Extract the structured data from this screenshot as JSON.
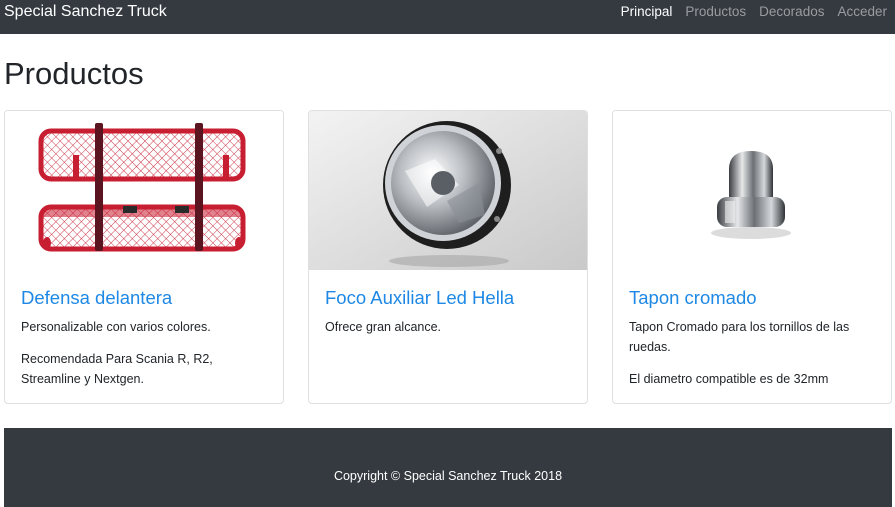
{
  "navbar": {
    "brand": "Special Sanchez Truck",
    "links": [
      {
        "label": "Principal",
        "active": true
      },
      {
        "label": "Productos",
        "active": false
      },
      {
        "label": "Decorados",
        "active": false
      },
      {
        "label": "Acceder",
        "active": false
      }
    ]
  },
  "page": {
    "title": "Productos"
  },
  "products": [
    {
      "title": "Defensa delantera",
      "image_icon": "red-grille-guard-image",
      "texts": [
        "Personalizable con varios colores.",
        "Recomendada Para Scania R, R2, Streamline y Nextgen."
      ]
    },
    {
      "title": "Foco Auxiliar Led Hella",
      "image_icon": "round-led-spotlight-image",
      "texts": [
        "Ofrece gran alcance."
      ]
    },
    {
      "title": "Tapon cromado",
      "image_icon": "chrome-nut-cap-image",
      "texts": [
        "Tapon Cromado para los tornillos de las ruedas.",
        "El diametro compatible es de 32mm"
      ]
    }
  ],
  "footer": {
    "copyright": "Copyright © Special Sanchez Truck 2018"
  },
  "colors": {
    "navbar_bg": "#343a40",
    "accent": "#1e88e5",
    "muted_nav": "#9a9da0"
  }
}
